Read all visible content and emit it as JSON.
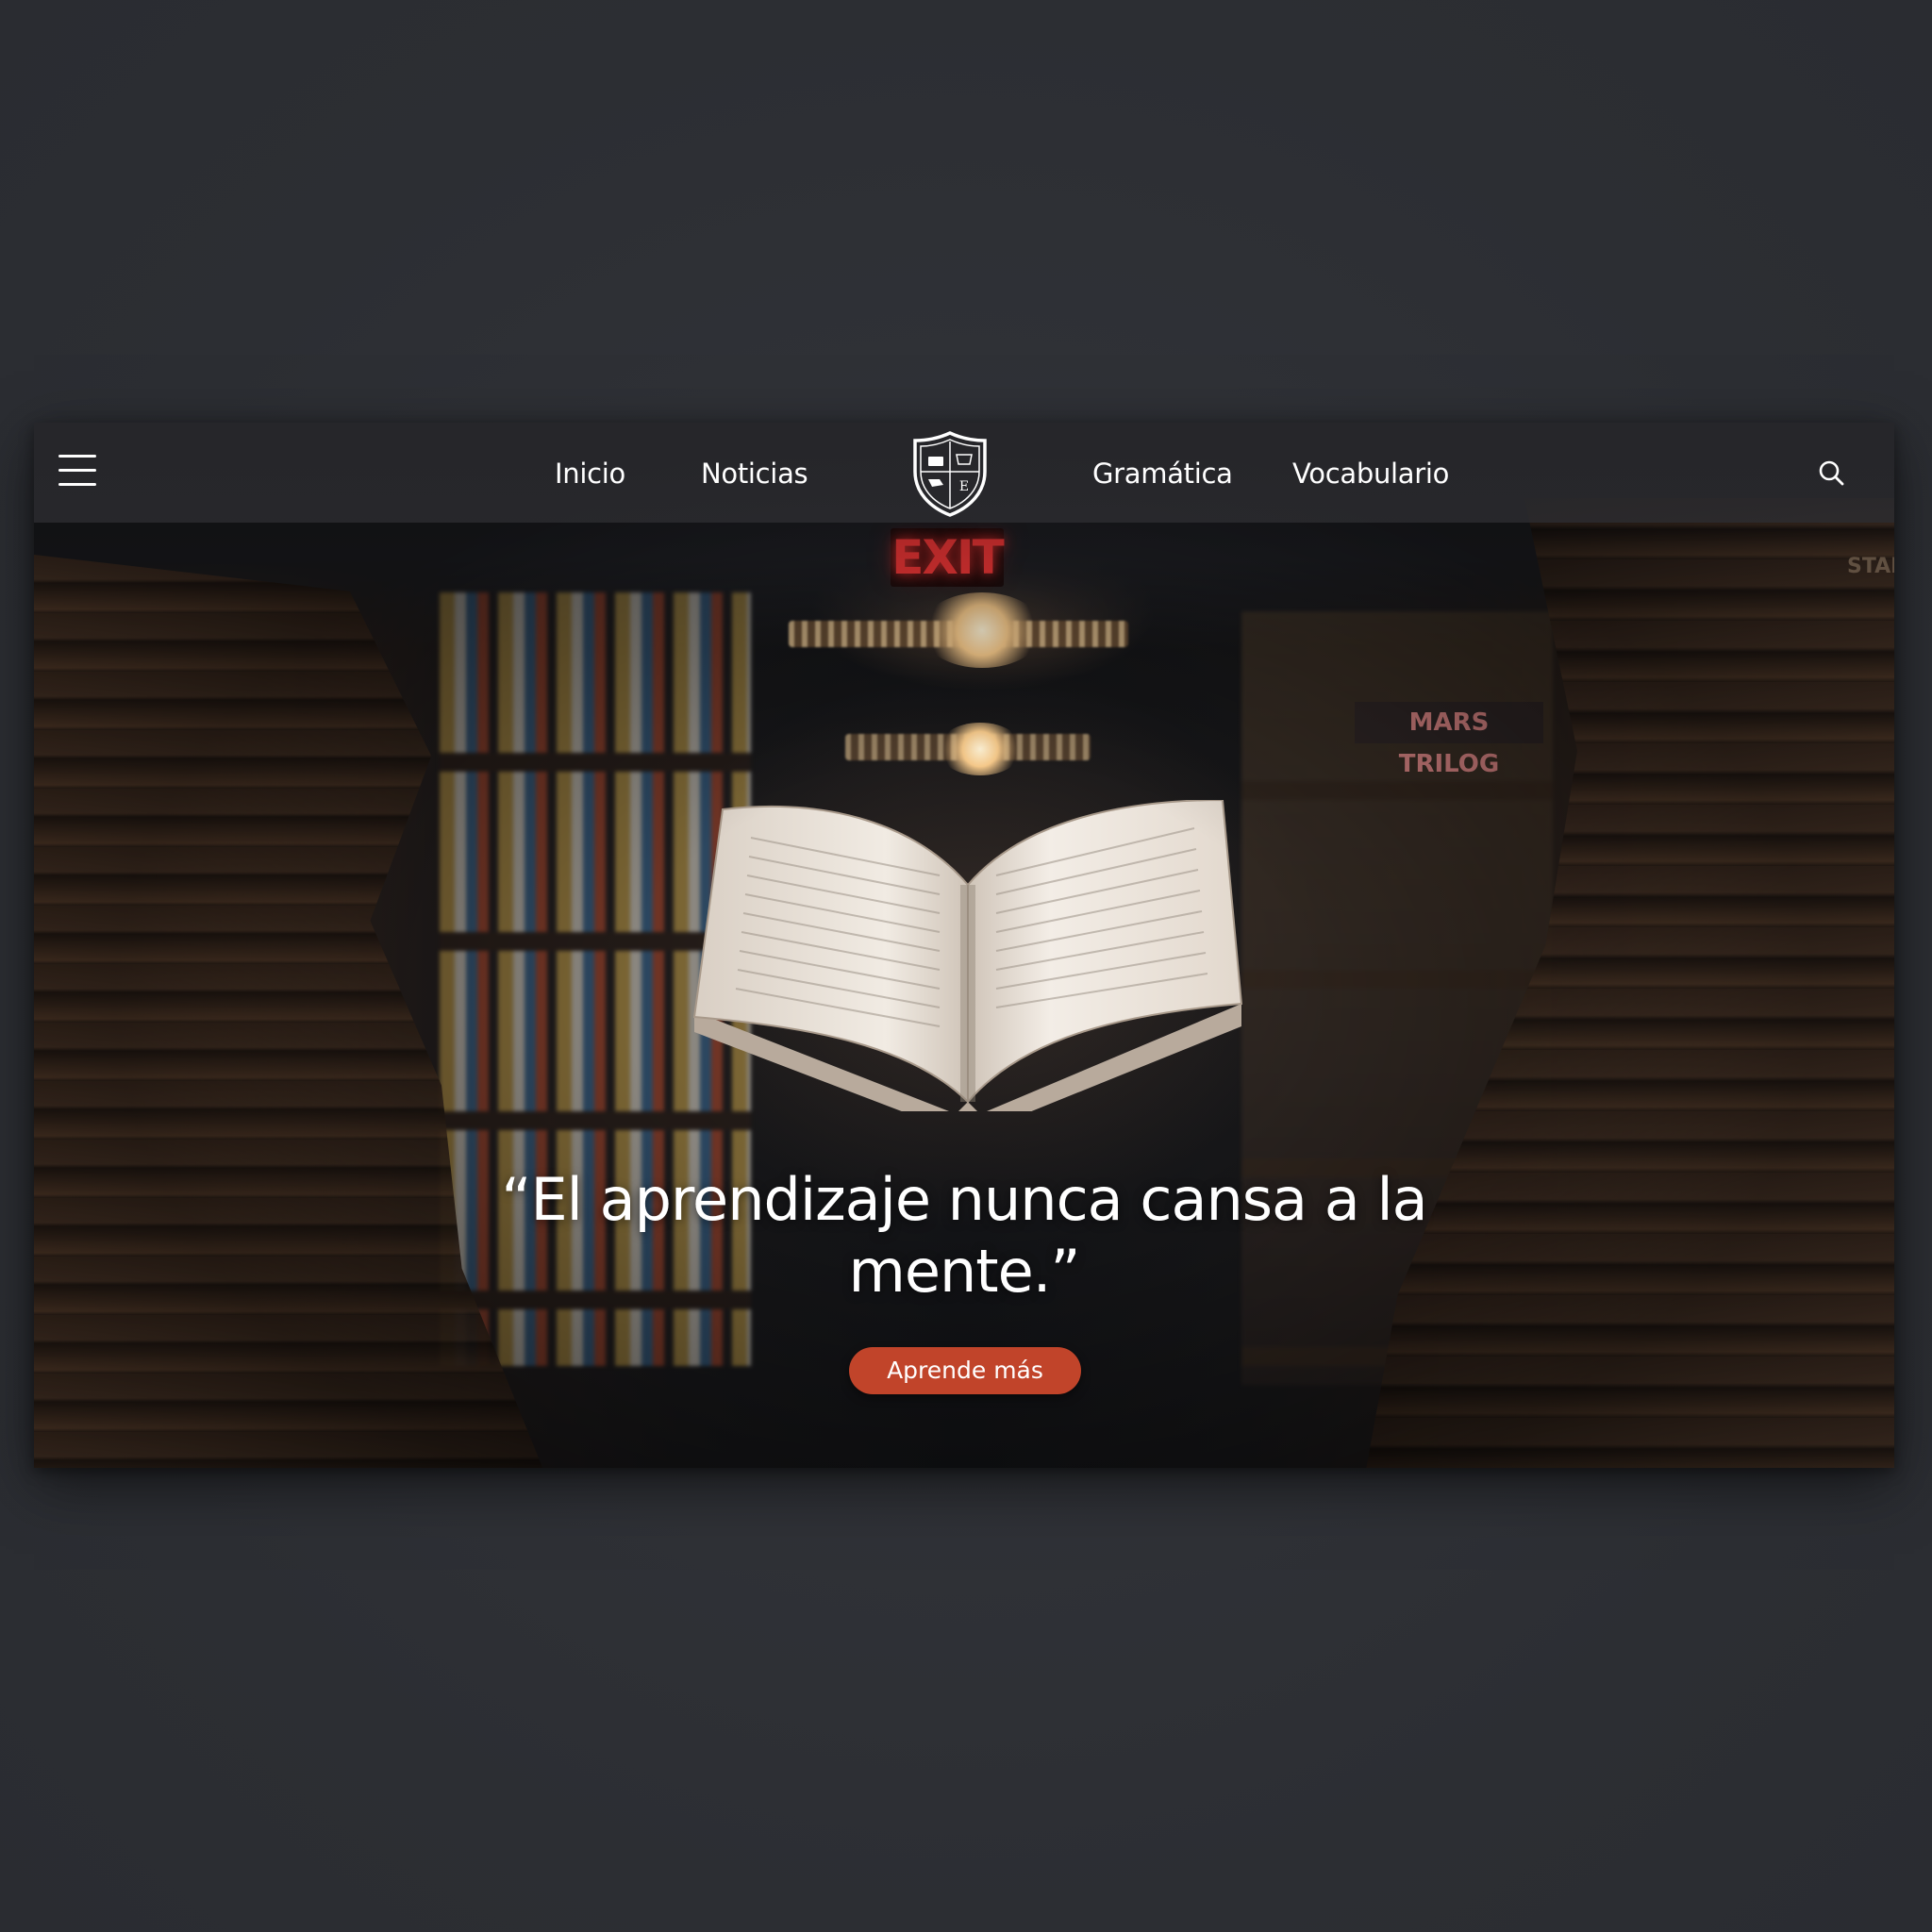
{
  "nav": {
    "items": [
      {
        "label": "Inicio"
      },
      {
        "label": "Noticias"
      },
      {
        "label": "Gramática"
      },
      {
        "label": "Vocabulario"
      }
    ],
    "logo_letter": "E"
  },
  "hero": {
    "quote": "“El aprendizaje nunca cansa a la mente.”",
    "cta_label": "Aprende más",
    "scene_text": {
      "exit_sign": "EXIT",
      "shelf_label": "MARS TRILOG",
      "edge_label": "STAN"
    }
  },
  "colors": {
    "background": "#2e3036",
    "navbar": "#2c2c30",
    "cta": "#c1442a",
    "text": "#ffffff"
  },
  "icons": {
    "menu": "hamburger-icon",
    "search": "search-icon",
    "logo": "shield-crest-icon"
  }
}
